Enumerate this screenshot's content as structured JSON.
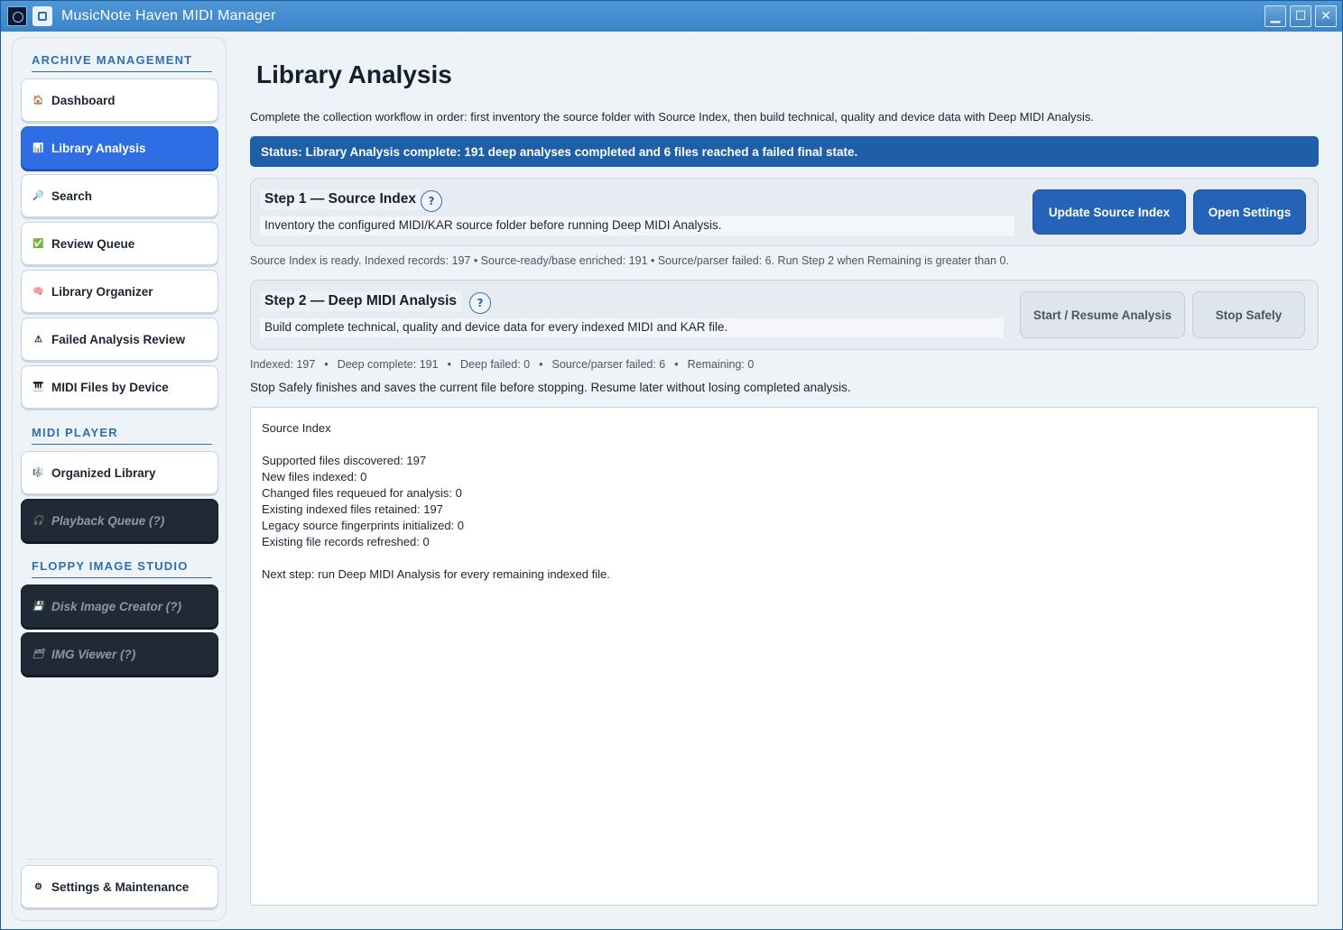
{
  "window": {
    "title": "MusicNote Haven MIDI Manager",
    "buttons": {
      "minimize": "▁",
      "maximize": "☐",
      "close": "✕"
    }
  },
  "sidebar": {
    "sections": {
      "archive": "ARCHIVE MANAGEMENT",
      "player": "MIDI PLAYER",
      "floppy": "FLOPPY IMAGE STUDIO"
    },
    "items": [
      {
        "label": "Dashboard",
        "icon": "🏠",
        "icon_name": "house-icon"
      },
      {
        "label": "Library Analysis",
        "icon": "📊",
        "icon_name": "chart-icon"
      },
      {
        "label": "Search",
        "icon": "🔎",
        "icon_name": "search-icon"
      },
      {
        "label": "Review Queue",
        "icon": "✅",
        "icon_name": "check-icon"
      },
      {
        "label": "Library Organizer",
        "icon": "🧠",
        "icon_name": "brain-icon"
      },
      {
        "label": "Failed Analysis Review",
        "icon": "⚠",
        "icon_name": "warning-icon"
      },
      {
        "label": "MIDI Files by Device",
        "icon": "🎹",
        "icon_name": "piano-icon"
      },
      {
        "label": "Organized Library",
        "icon": "🎼",
        "icon_name": "music-score-icon"
      },
      {
        "label": "Playback Queue  (?)",
        "icon": "🎧",
        "icon_name": "headphones-icon"
      },
      {
        "label": "Disk Image Creator  (?)",
        "icon": "💾",
        "icon_name": "floppy-disk-icon"
      },
      {
        "label": "IMG Viewer  (?)",
        "icon": "🗂",
        "icon_name": "folder-icon"
      },
      {
        "label": "Settings & Maintenance",
        "icon": "⚙",
        "icon_name": "gear-icon"
      }
    ]
  },
  "main": {
    "title": "Library Analysis",
    "intro": "Complete the collection workflow in order: first inventory the source folder with Source Index, then build technical, quality and device data with Deep MIDI Analysis.",
    "status": "Status: Library Analysis complete: 191 deep analyses completed and 6 files reached a failed final state.",
    "step1": {
      "title": "Step 1 — Source Index",
      "desc": "Inventory the configured MIDI/KAR source folder before running Deep MIDI Analysis.",
      "help": "?",
      "btn_update": "Update Source Index",
      "btn_settings": "Open Settings"
    },
    "source_info": "Source Index is ready. Indexed records: 197 • Source-ready/base enriched: 191 • Source/parser failed: 6. Run Step 2 when Remaining is greater than 0.",
    "step2": {
      "title": "Step 2 — Deep MIDI Analysis",
      "desc": "Build complete technical, quality and device data for every indexed MIDI and KAR file.",
      "help": "?",
      "btn_start": "Start / Resume Analysis",
      "btn_stop": "Stop Safely"
    },
    "metrics": {
      "indexed": "Indexed: 197",
      "deep_complete": "Deep complete: 191",
      "deep_failed": "Deep failed: 0",
      "source_failed": "Source/parser failed: 6",
      "remaining": "Remaining: 0",
      "separator": "•"
    },
    "stop_note": "Stop Safely finishes and saves the current file before stopping. Resume later without losing completed analysis.",
    "log": [
      "Source Index",
      "",
      "Supported files discovered: 197",
      "New files indexed: 0",
      "Changed files requeued for analysis: 0",
      "Existing indexed files retained: 197",
      "Legacy source fingerprints initialized: 0",
      "Existing file records refreshed: 0",
      "",
      "Next step: run Deep MIDI Analysis for every remaining indexed file."
    ]
  },
  "colors": {
    "accent": "#2f6de5",
    "status_bar": "#1f5fa8",
    "primary_button": "#2563b8",
    "dark_item": "#202a36"
  }
}
